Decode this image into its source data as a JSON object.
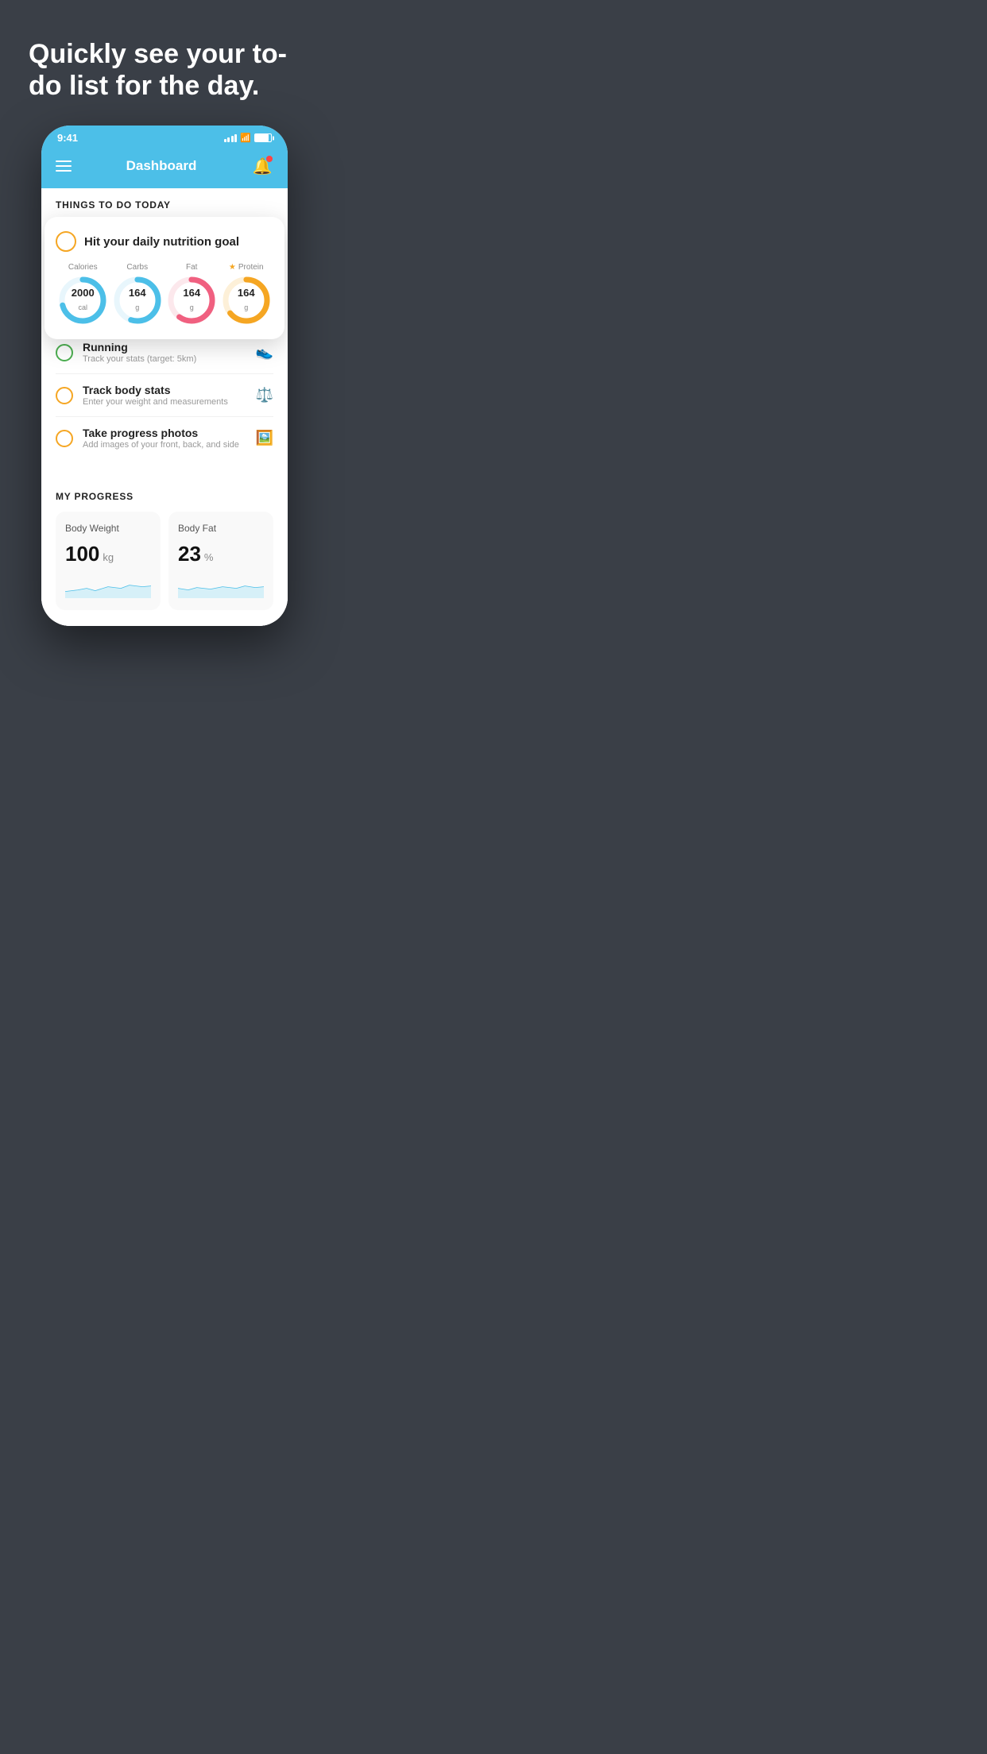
{
  "hero": {
    "title": "Quickly see your to-do list for the day."
  },
  "phone": {
    "status_bar": {
      "time": "9:41",
      "signal_bars": 4,
      "wifi": true,
      "battery": 85
    },
    "header": {
      "title": "Dashboard",
      "notification_dot": true
    },
    "things_today_heading": "THINGS TO DO TODAY",
    "nutrition_card": {
      "title": "Hit your daily nutrition goal",
      "macros": [
        {
          "label": "Calories",
          "value": "2000",
          "unit": "cal",
          "color": "#4cbfe8",
          "pct": 72
        },
        {
          "label": "Carbs",
          "value": "164",
          "unit": "g",
          "color": "#4cbfe8",
          "pct": 55
        },
        {
          "label": "Fat",
          "value": "164",
          "unit": "g",
          "color": "#f06080",
          "pct": 60
        },
        {
          "label": "Protein",
          "value": "164",
          "unit": "g",
          "color": "#f5a623",
          "pct": 80,
          "starred": true
        }
      ]
    },
    "todo_items": [
      {
        "id": "running",
        "label": "Running",
        "sub": "Track your stats (target: 5km)",
        "circle_color": "green",
        "icon": "👟"
      },
      {
        "id": "body-stats",
        "label": "Track body stats",
        "sub": "Enter your weight and measurements",
        "circle_color": "yellow",
        "icon": "⚖️"
      },
      {
        "id": "progress-photos",
        "label": "Take progress photos",
        "sub": "Add images of your front, back, and side",
        "circle_color": "yellow",
        "icon": "🖼️"
      }
    ],
    "progress": {
      "heading": "MY PROGRESS",
      "cards": [
        {
          "title": "Body Weight",
          "value": "100",
          "unit": "kg"
        },
        {
          "title": "Body Fat",
          "value": "23",
          "unit": "%"
        }
      ]
    }
  }
}
